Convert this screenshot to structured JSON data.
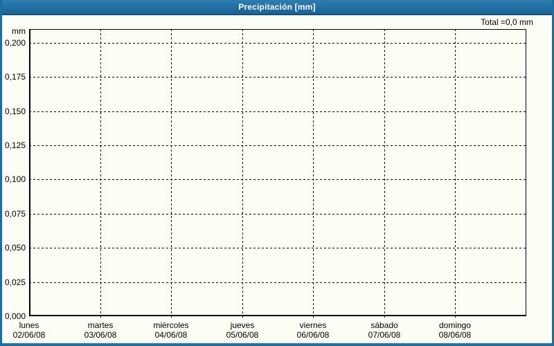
{
  "titlebar": {
    "title": "Precipitación [mm]"
  },
  "summary": {
    "total_label": "Total =0,0 mm"
  },
  "axes": {
    "unit_label": "mm"
  },
  "colors": {
    "accent_blue": "#1e6da1",
    "titlebar_top": "#2f7cb0",
    "titlebar_bottom": "#1b679c",
    "titlebar_line": "#124e7a",
    "background": "#fcfdf4",
    "grid": "#000000",
    "text": "#000000",
    "title_text": "#ffffff"
  },
  "chart_data": {
    "type": "bar",
    "title": "Precipitación [mm]",
    "xlabel": "",
    "ylabel": "mm",
    "ylim": [
      0,
      0.21
    ],
    "grid": "dashed",
    "legend_position": "none",
    "total_text": "Total =0,0 mm",
    "total_value_mm": 0.0,
    "yticks": [
      {
        "label": "0,200",
        "value": 0.2
      },
      {
        "label": "0,175",
        "value": 0.175
      },
      {
        "label": "0,150",
        "value": 0.15
      },
      {
        "label": "0,125",
        "value": 0.125
      },
      {
        "label": "0,100",
        "value": 0.1
      },
      {
        "label": "0,075",
        "value": 0.075
      },
      {
        "label": "0,050",
        "value": 0.05
      },
      {
        "label": "0,025",
        "value": 0.025
      },
      {
        "label": "0,000",
        "value": 0.0
      }
    ],
    "categories": [
      {
        "day": "lunes",
        "date": "02/06/08"
      },
      {
        "day": "martes",
        "date": "03/06/08"
      },
      {
        "day": "miércoles",
        "date": "04/06/08"
      },
      {
        "day": "jueves",
        "date": "05/06/08"
      },
      {
        "day": "viernes",
        "date": "06/06/08"
      },
      {
        "day": "sábado",
        "date": "07/06/08"
      },
      {
        "day": "domingo",
        "date": "08/06/08"
      }
    ],
    "series": [
      {
        "name": "Precipitación",
        "values": [
          0,
          0,
          0,
          0,
          0,
          0,
          0
        ]
      }
    ]
  }
}
